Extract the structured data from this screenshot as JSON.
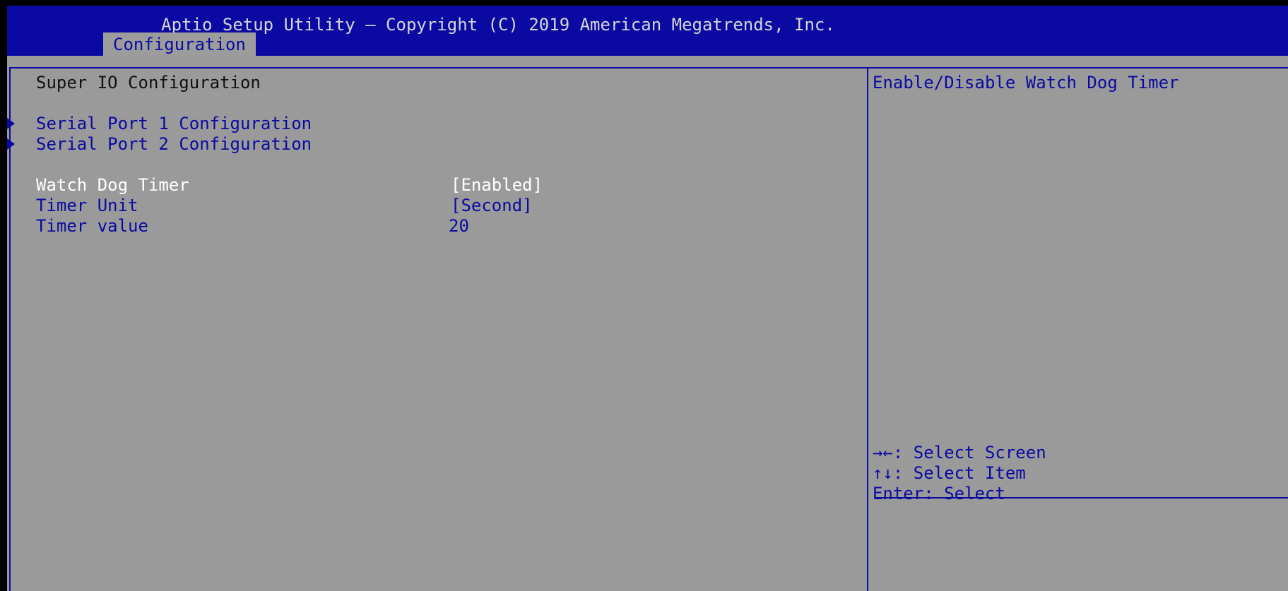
{
  "header": {
    "title": "Aptio Setup Utility – Copyright (C) 2019 American Megatrends, Inc.",
    "active_tab": "Configuration"
  },
  "main": {
    "section_title": "Super IO Configuration",
    "submenus": [
      {
        "label": "Serial Port 1 Configuration"
      },
      {
        "label": "Serial Port 2 Configuration"
      }
    ],
    "settings": [
      {
        "label": "Watch Dog Timer",
        "value": "[Enabled]",
        "selected": true
      },
      {
        "label": "Timer Unit",
        "value": "[Second]",
        "selected": false
      },
      {
        "label": "Timer value",
        "value": "20",
        "selected": false
      }
    ]
  },
  "help": {
    "description": "Enable/Disable Watch Dog Timer",
    "keys": [
      "→←: Select Screen",
      "↑↓: Select Item",
      "Enter: Select"
    ]
  },
  "colors": {
    "bar_blue": "#0a0aa2",
    "panel_gray": "#9a9a9a",
    "selected_text": "#ffffff"
  }
}
